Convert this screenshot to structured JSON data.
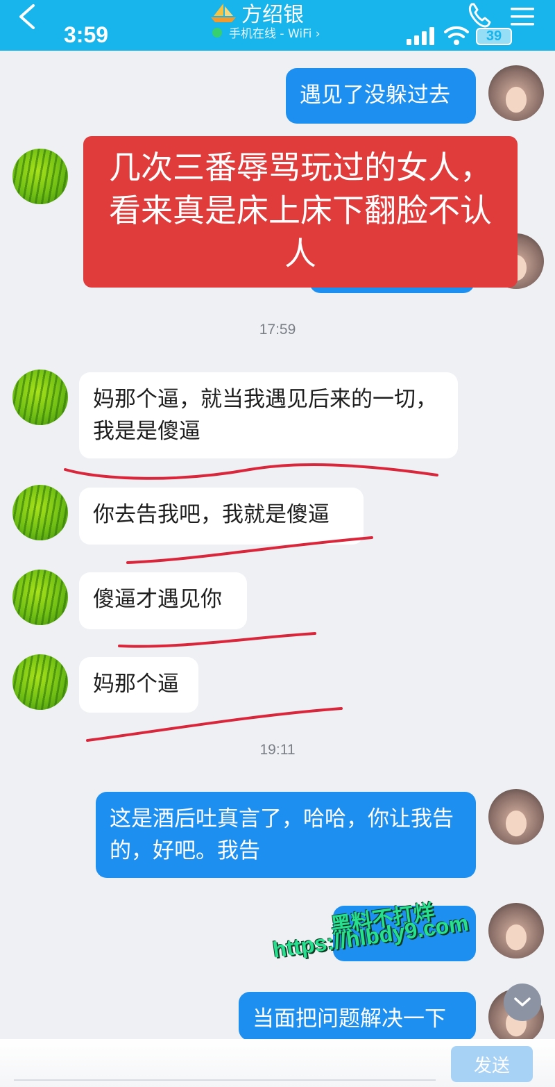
{
  "status_bar": {
    "time": "3:59",
    "battery": "39"
  },
  "header": {
    "contact_name": "方绍银",
    "status": "手机在线 - WiFi ›"
  },
  "messages": [
    {
      "side": "out",
      "text": "遇见了没躲过去"
    },
    {
      "side": "in",
      "text": "妈那个逼，就当我遇见后来的一切，我是是傻逼"
    },
    {
      "side": "in",
      "text": "你去告我吧，我就是傻逼"
    },
    {
      "side": "in",
      "text": "傻逼才遇见你"
    },
    {
      "side": "in",
      "text": "妈那个逼"
    },
    {
      "side": "out",
      "text": "这是酒后吐真言了，哈哈，你让我告的，好吧。我告"
    },
    {
      "side": "out",
      "text": "当面把问题解决一下"
    }
  ],
  "timestamps": [
    "17:59",
    "19:11"
  ],
  "overlay": {
    "text": "几次三番辱骂玩过的女人，看来真是床上床下翻脸不认人",
    "color": "#e03c3c"
  },
  "watermark": {
    "line1": "黑料不打烊",
    "line2": "https://hlbdy9.com"
  },
  "input_bar": {
    "send_label": "发送"
  },
  "colors": {
    "header": "#18b4ec",
    "outgoing_bubble": "#1d8ff0",
    "incoming_bubble": "#ffffff",
    "underline": "#d9263a"
  }
}
